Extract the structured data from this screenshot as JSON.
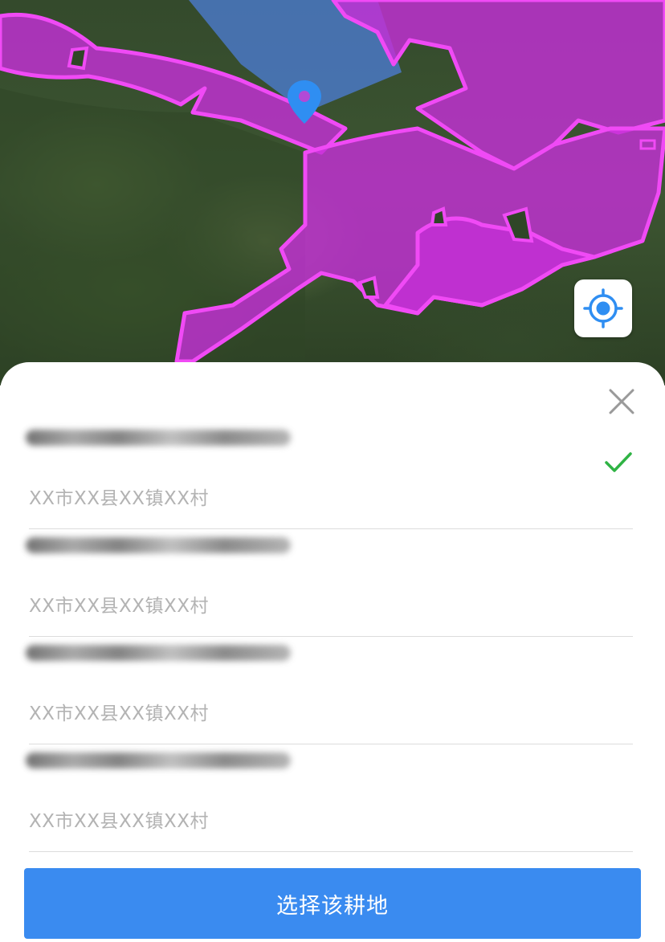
{
  "map": {
    "pin_icon": "location-pin-icon",
    "locate_icon": "crosshair-target-icon",
    "colors": {
      "farmland_fill": "#c32fd6",
      "farmland_border": "#f04af5",
      "selected_area": "#4a78c4",
      "pin": "#2f8ef2"
    }
  },
  "sheet": {
    "close_icon": "close-icon",
    "items": [
      {
        "name": "",
        "address": "XX市XX县XX镇XX村",
        "selected": true
      },
      {
        "name": "",
        "address": "XX市XX县XX镇XX村",
        "selected": false
      },
      {
        "name": "",
        "address": "XX市XX县XX镇XX村",
        "selected": false
      },
      {
        "name": "",
        "address": "XX市XX县XX镇XX村",
        "selected": false
      }
    ],
    "check_icon": "checkmark-icon",
    "check_color": "#2fb344",
    "confirm_label": "选择该耕地",
    "confirm_color": "#3a8bf0"
  }
}
